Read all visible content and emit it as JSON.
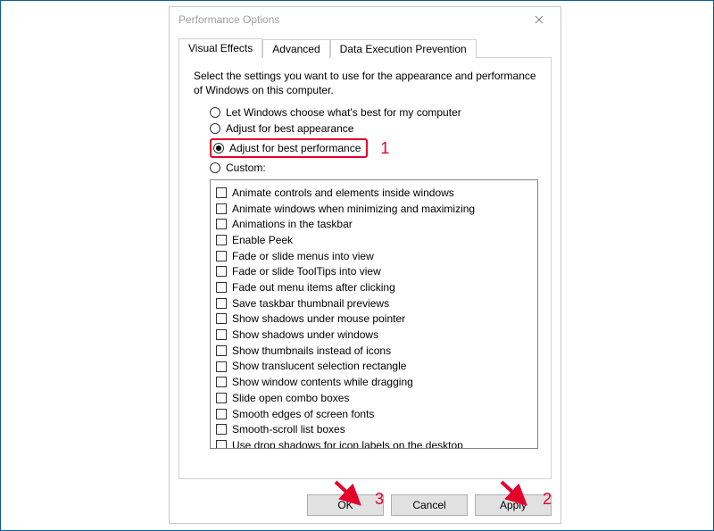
{
  "window": {
    "title": "Performance Options",
    "close_aria": "Close"
  },
  "tabs": {
    "visual_effects": "Visual Effects",
    "advanced": "Advanced",
    "dep": "Data Execution Prevention"
  },
  "intro": "Select the settings you want to use for the appearance and performance of Windows on this computer.",
  "radios": {
    "let_windows": "Let Windows choose what's best for my computer",
    "best_appearance": "Adjust for best appearance",
    "best_performance": "Adjust for best performance",
    "custom": "Custom:",
    "selected": "best_performance"
  },
  "options": [
    "Animate controls and elements inside windows",
    "Animate windows when minimizing and maximizing",
    "Animations in the taskbar",
    "Enable Peek",
    "Fade or slide menus into view",
    "Fade or slide ToolTips into view",
    "Fade out menu items after clicking",
    "Save taskbar thumbnail previews",
    "Show shadows under mouse pointer",
    "Show shadows under windows",
    "Show thumbnails instead of icons",
    "Show translucent selection rectangle",
    "Show window contents while dragging",
    "Slide open combo boxes",
    "Smooth edges of screen fonts",
    "Smooth-scroll list boxes",
    "Use drop shadows for icon labels on the desktop"
  ],
  "buttons": {
    "ok": "OK",
    "cancel": "Cancel",
    "apply": "Apply"
  },
  "annotations": {
    "step1": "1",
    "step2": "2",
    "step3": "3"
  },
  "colors": {
    "annotation_red": "#e4002b",
    "frame_blue": "#0a5c9e"
  }
}
